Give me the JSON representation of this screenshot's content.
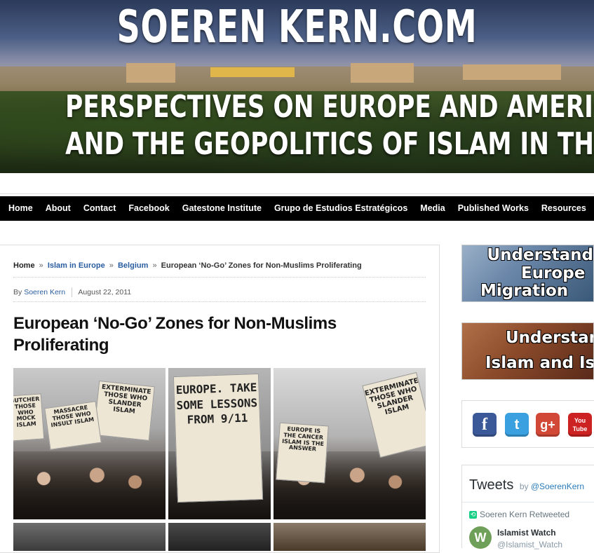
{
  "header": {
    "site_title": "SOEREN KERN.COM",
    "tagline_line1": "PERSPECTIVES ON EUROPE AND AMERICA",
    "tagline_line2": "AND THE GEOPOLITICS OF ISLAM IN THE WEST"
  },
  "nav": {
    "items": [
      "Home",
      "About",
      "Contact",
      "Facebook",
      "Gatestone Institute",
      "Grupo de Estudios Estratégicos",
      "Media",
      "Published Works",
      "Resources"
    ]
  },
  "breadcrumb": {
    "home": "Home",
    "sep": "»",
    "cat1": "Islam in Europe",
    "cat2": "Belgium",
    "current": "European ‘No-Go’ Zones for Non-Muslims Proliferating"
  },
  "meta": {
    "by": "By",
    "author": "Soeren Kern",
    "date": "August 22, 2011"
  },
  "post": {
    "title": "European ‘No-Go’ Zones for Non-Muslims Proliferating"
  },
  "photos": {
    "p1_sign_a": "EXTERMINATE THOSE WHO SLANDER ISLAM",
    "p1_sign_b": "MASSACRE THOSE WHO INSULT ISLAM",
    "p1_sign_c": "BUTCHER THOSE WHO MOCK ISLAM",
    "p2_sign": "EUROPE. TAKE SOME LESSONS FROM 9/11",
    "p3_sign_a": "EXTERMINATE THOSE WHO SLANDER ISLAM",
    "p3_sign_b": "EUROPE IS THE CANCER ISLAM IS THE ANSWER"
  },
  "sidebar": {
    "ad1_line1": "Understand",
    "ad1_line2": "Europe",
    "ad1_line3": "Migration",
    "ad2_line1": "Understand",
    "ad2_line2": "Islam and Isla",
    "social": {
      "facebook_glyph": "f",
      "twitter_glyph": "t",
      "gplus_glyph": "g+",
      "youtube_glyph": "You Tube"
    },
    "tweets": {
      "title": "Tweets",
      "by": "by",
      "handle": "@SoerenKern",
      "retweet_text": "Soeren Kern Retweeted",
      "retweet_glyph": "⟲",
      "user_initial": "W",
      "user_name": "Islamist Watch",
      "user_handle": "@Islamist_Watch"
    }
  }
}
